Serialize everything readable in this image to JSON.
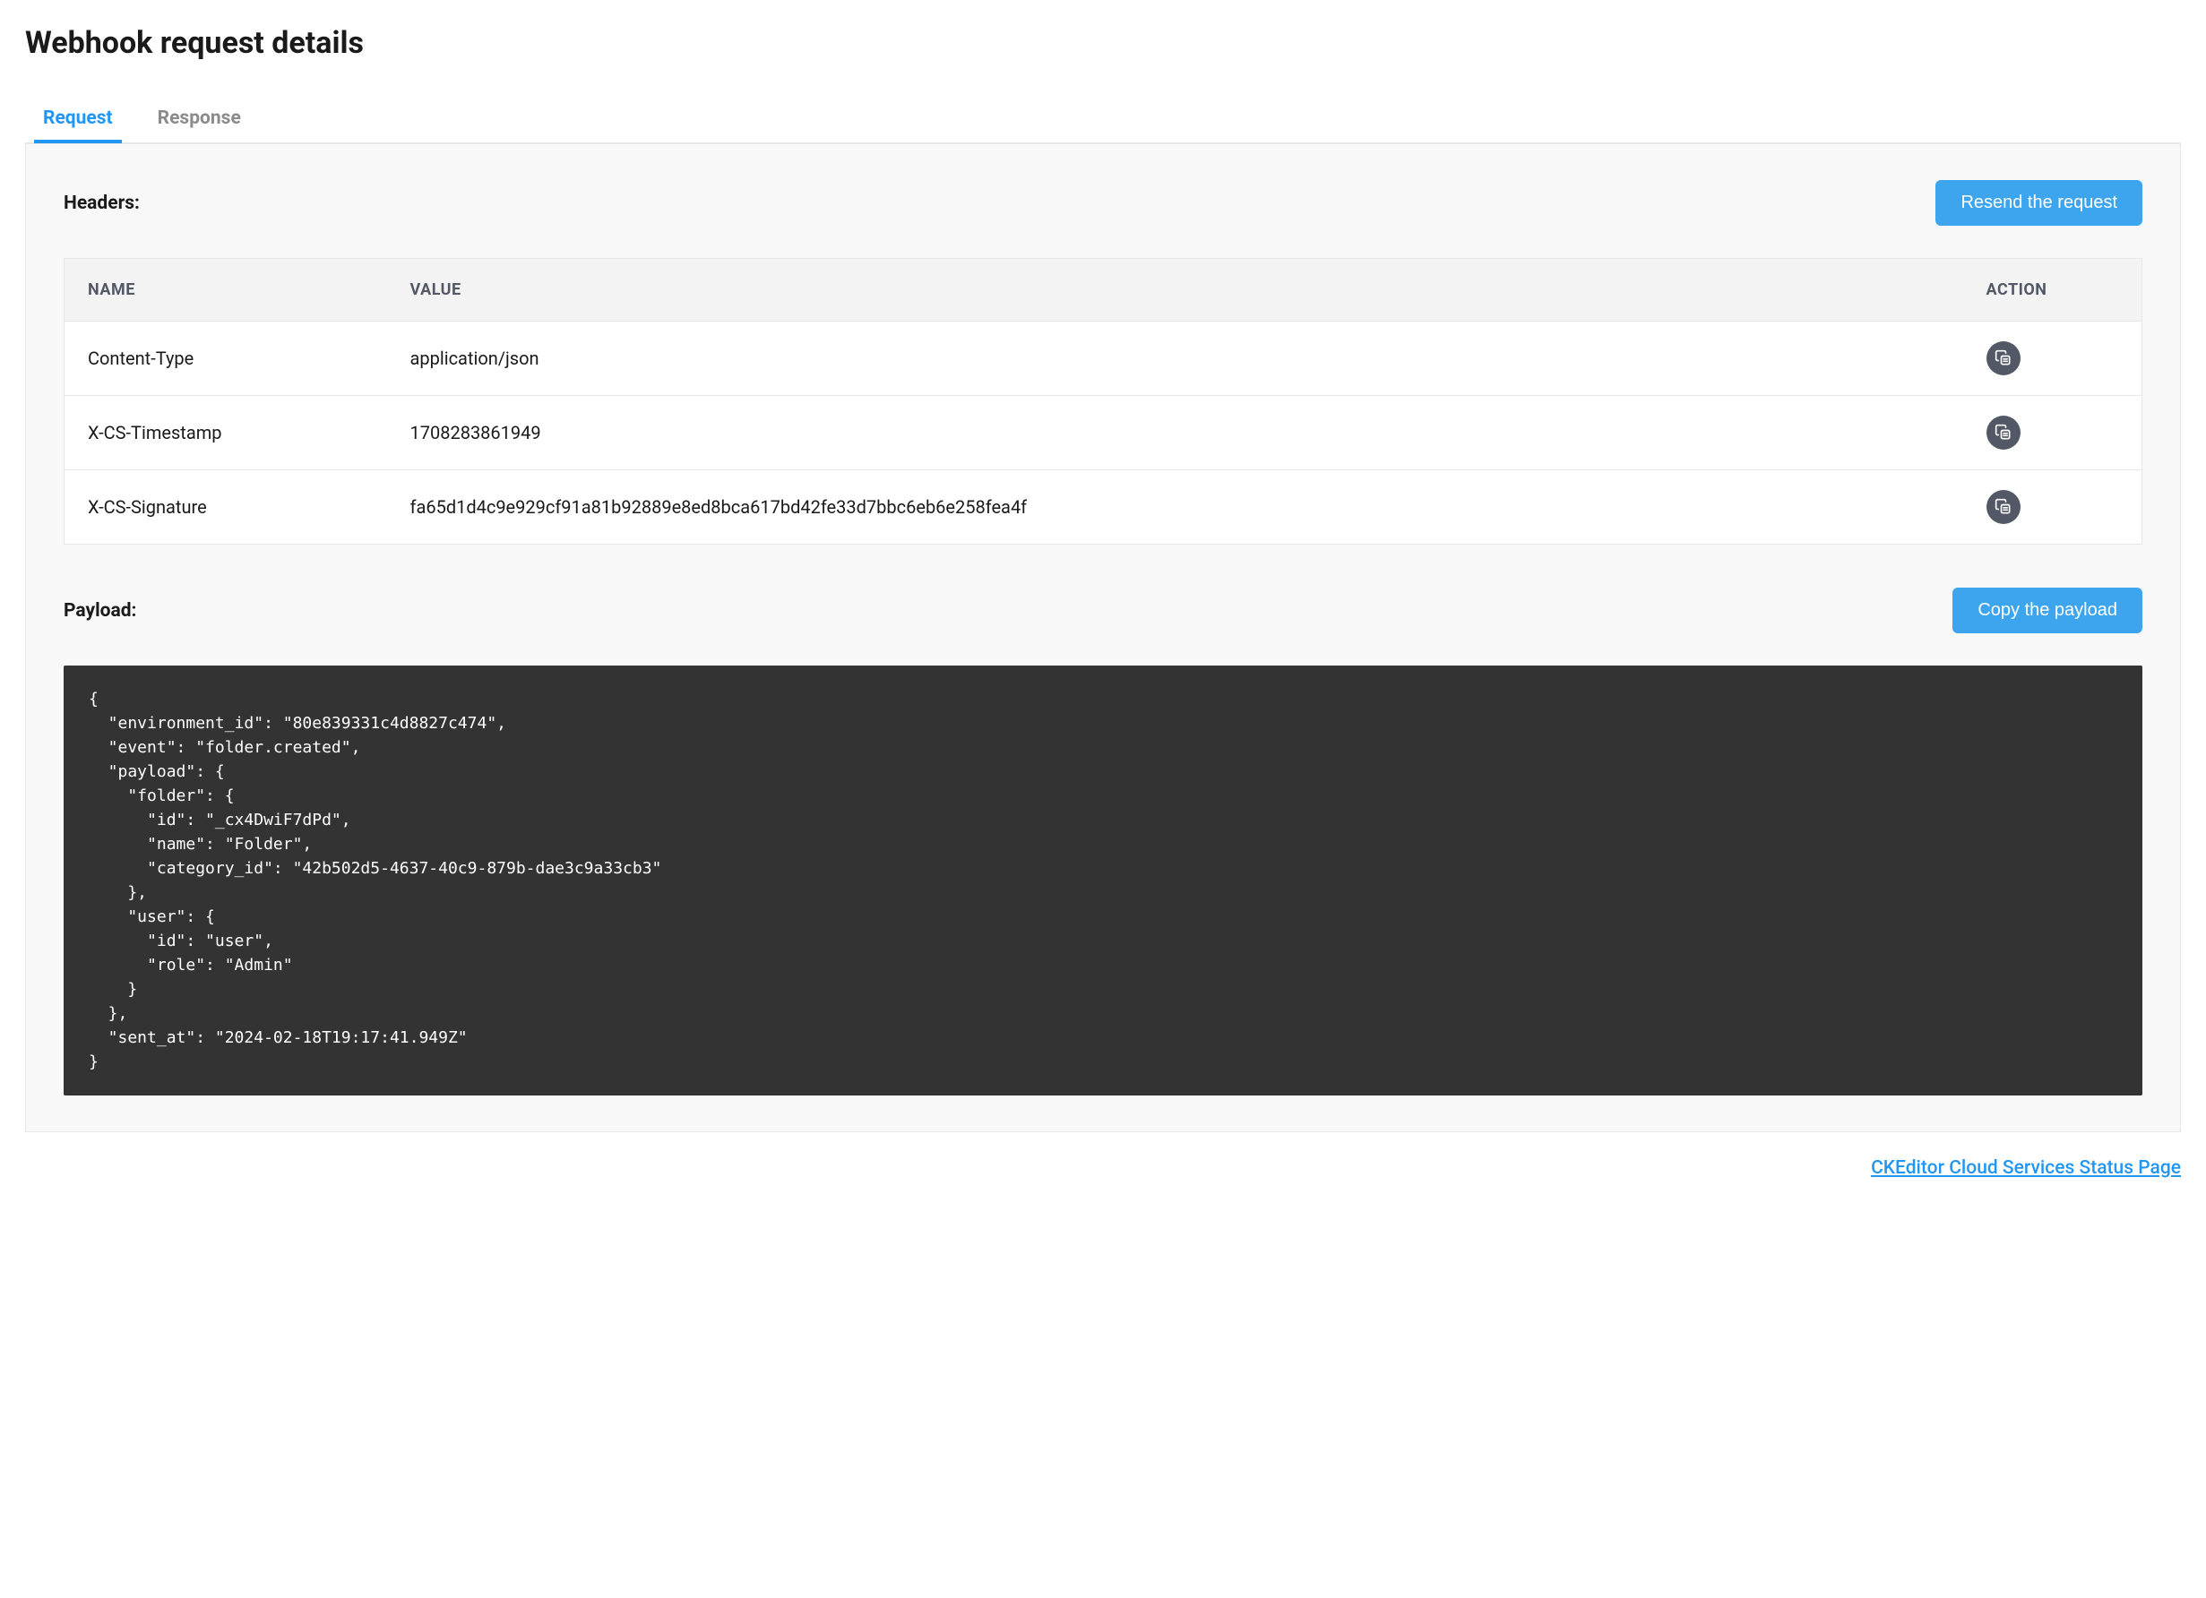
{
  "page_title": "Webhook request details",
  "tabs": [
    {
      "label": "Request",
      "active": true
    },
    {
      "label": "Response",
      "active": false
    }
  ],
  "sections": {
    "headers": {
      "title": "Headers:",
      "resend_button": "Resend the request",
      "columns": {
        "name": "NAME",
        "value": "VALUE",
        "action": "ACTION"
      },
      "rows": [
        {
          "name": "Content-Type",
          "value": "application/json"
        },
        {
          "name": "X-CS-Timestamp",
          "value": "1708283861949"
        },
        {
          "name": "X-CS-Signature",
          "value": "fa65d1d4c9e929cf91a81b92889e8ed8bca617bd42fe33d7bbc6eb6e258fea4f"
        }
      ]
    },
    "payload": {
      "title": "Payload:",
      "copy_button": "Copy the payload",
      "body": "{\n  \"environment_id\": \"80e839331c4d8827c474\",\n  \"event\": \"folder.created\",\n  \"payload\": {\n    \"folder\": {\n      \"id\": \"_cx4DwiF7dPd\",\n      \"name\": \"Folder\",\n      \"category_id\": \"42b502d5-4637-40c9-879b-dae3c9a33cb3\"\n    },\n    \"user\": {\n      \"id\": \"user\",\n      \"role\": \"Admin\"\n    }\n  },\n  \"sent_at\": \"2024-02-18T19:17:41.949Z\"\n}"
    }
  },
  "footer": {
    "status_link": "CKEditor Cloud Services Status Page"
  }
}
